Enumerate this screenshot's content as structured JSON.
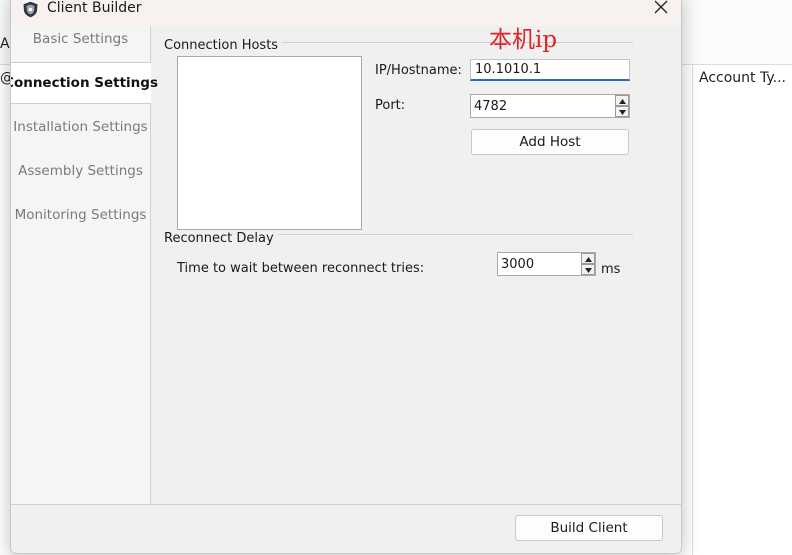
{
  "background": {
    "left_fragments": [
      "Ab",
      "@"
    ],
    "column_header": "Account Ty..."
  },
  "dialog": {
    "title": "Client Builder",
    "app_icon": "shield-icon",
    "close_icon": "close-icon"
  },
  "sidebar": {
    "items": [
      {
        "label": "Basic Settings",
        "active": false
      },
      {
        "label": "Connection Settings",
        "active": true
      },
      {
        "label": "Installation Settings",
        "active": false
      },
      {
        "label": "Assembly Settings",
        "active": false
      },
      {
        "label": "Monitoring Settings",
        "active": false
      }
    ]
  },
  "connection_hosts": {
    "group_title": "Connection Hosts",
    "hosts": [],
    "ip_label": "IP/Hostname:",
    "ip_value": "10.1010.1",
    "port_label": "Port:",
    "port_value": "4782",
    "add_host_label": "Add Host",
    "annotation": "本机ip"
  },
  "reconnect_delay": {
    "group_title": "Reconnect Delay",
    "label": "Time to wait between reconnect tries:",
    "value": "3000",
    "unit": "ms"
  },
  "footer": {
    "build_label": "Build Client"
  },
  "colors": {
    "annotation": "#e0242a",
    "focus_underline": "#2a6db5",
    "dialog_bg": "#f0f0f0",
    "titlebar_bg": "#f7f2ef"
  }
}
